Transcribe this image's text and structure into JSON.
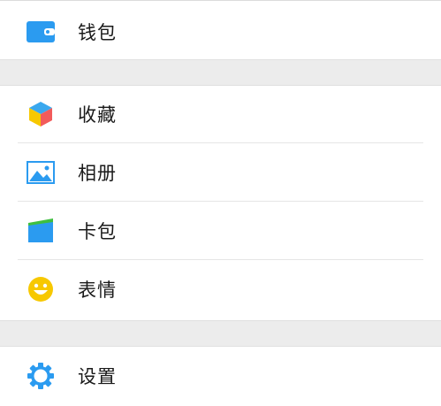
{
  "menu": {
    "wallet": {
      "label": "钱包",
      "icon": "wallet-icon"
    },
    "favorites": {
      "label": "收藏",
      "icon": "cube-icon"
    },
    "album": {
      "label": "相册",
      "icon": "photo-icon"
    },
    "cards": {
      "label": "卡包",
      "icon": "card-holder-icon"
    },
    "stickers": {
      "label": "表情",
      "icon": "smiley-icon"
    },
    "settings": {
      "label": "设置",
      "icon": "gear-icon"
    }
  },
  "colors": {
    "background": "#ececec",
    "row_background": "#ffffff",
    "accent_blue": "#2b9bf0",
    "yellow": "#f7c800",
    "green": "#3fbf3f",
    "red": "#f25b5b"
  }
}
